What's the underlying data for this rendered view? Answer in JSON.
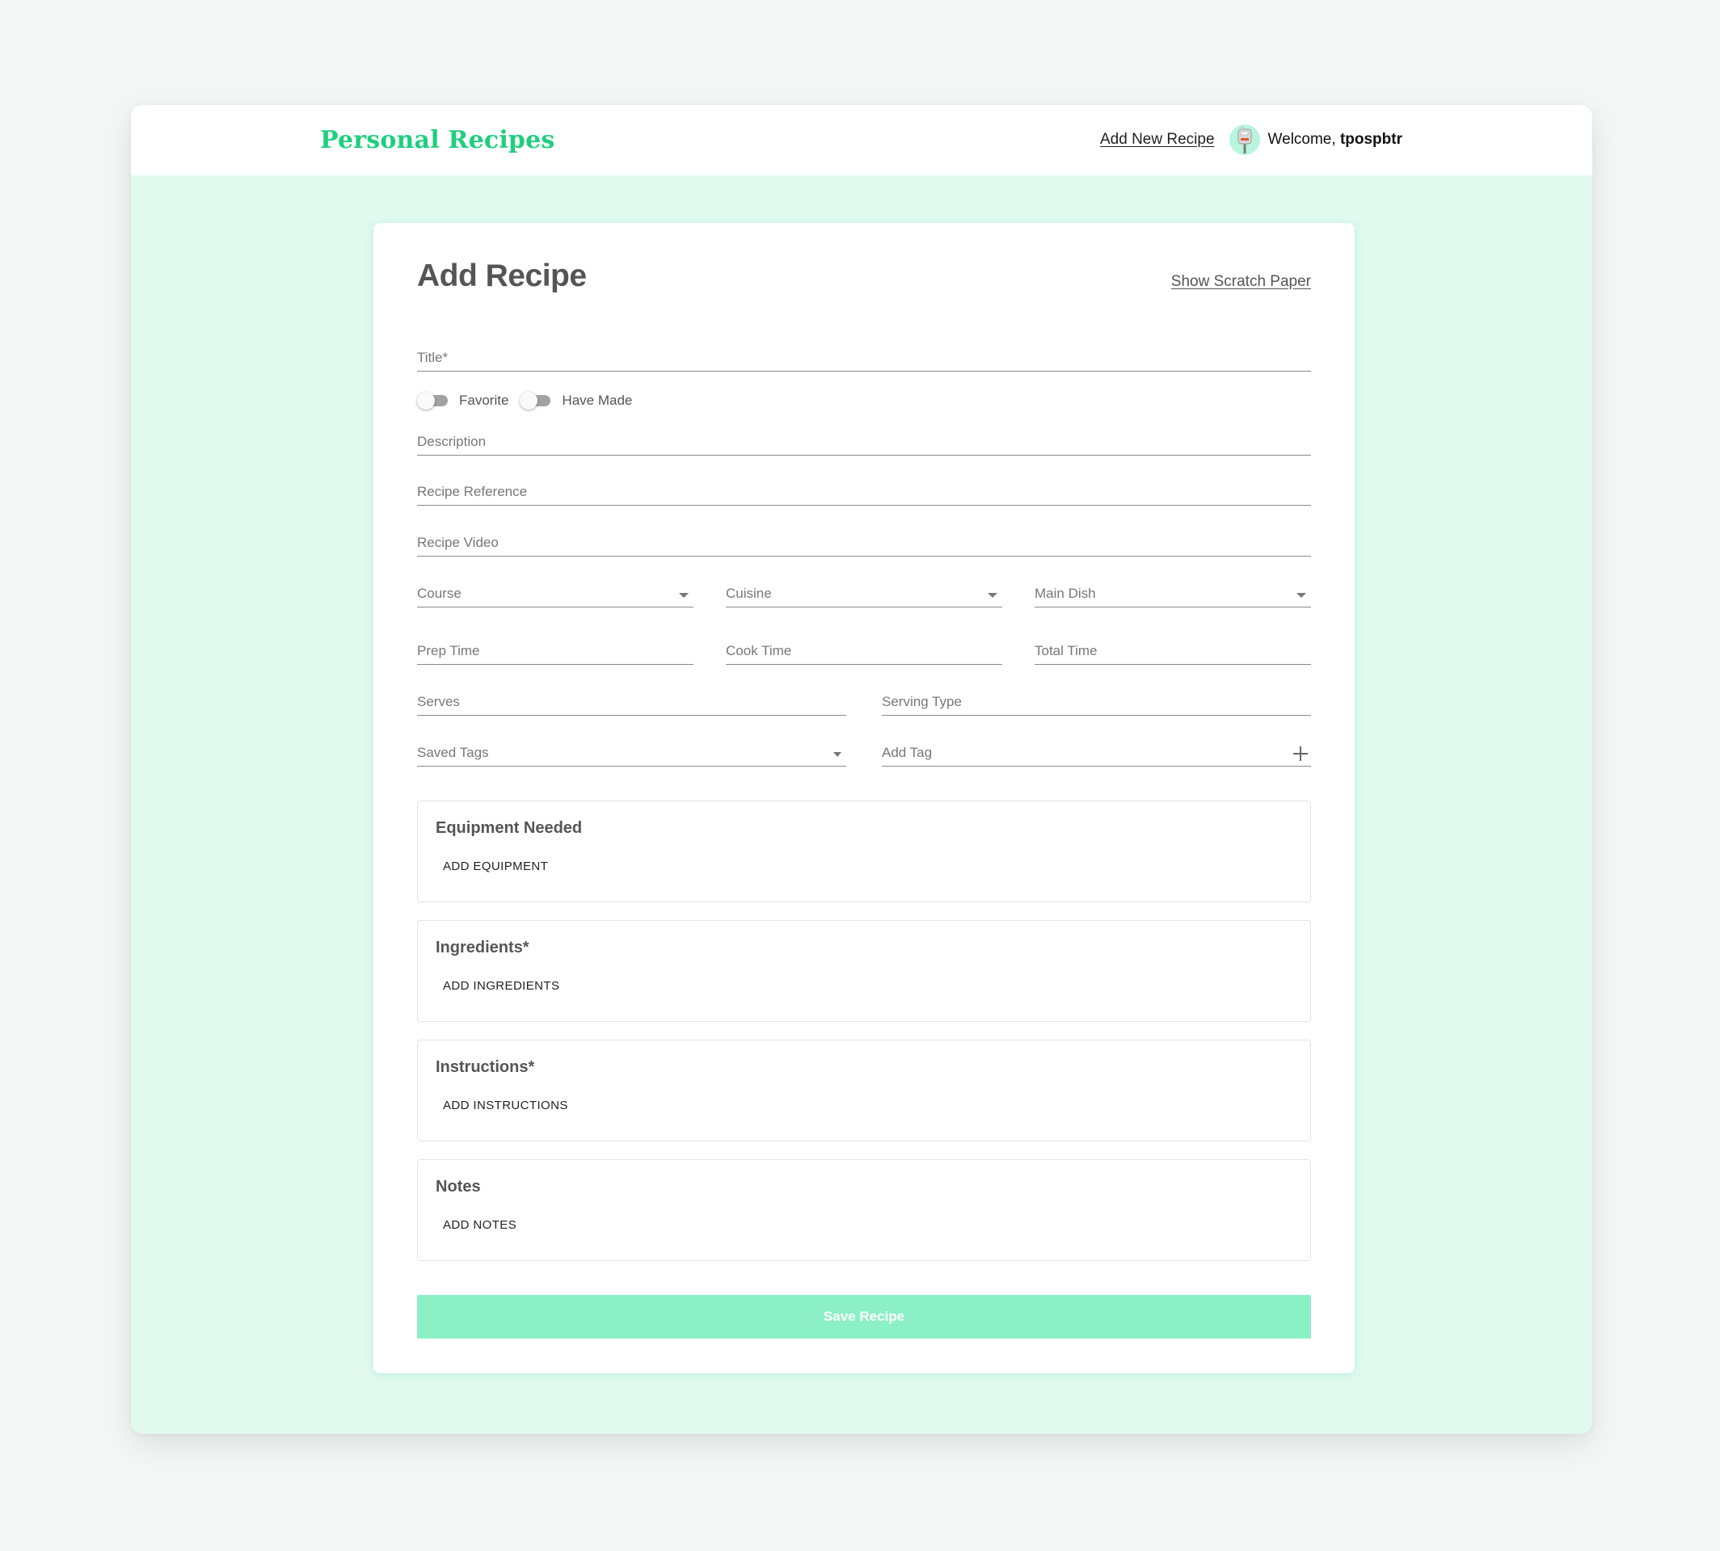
{
  "header": {
    "brand": "Personal Recipes",
    "add_new_recipe": "Add New Recipe",
    "welcome_prefix": "Welcome, ",
    "username": "tpospbtr",
    "avatar_icon": "parking-meter-avatar-icon"
  },
  "page": {
    "title": "Add Recipe",
    "scratch_link": "Show Scratch Paper"
  },
  "form": {
    "title_label": "Title*",
    "toggles": [
      {
        "label": "Favorite",
        "on": false
      },
      {
        "label": "Have Made",
        "on": false
      }
    ],
    "description_label": "Description",
    "reference_label": "Recipe Reference",
    "video_label": "Recipe Video",
    "course_label": "Course",
    "cuisine_label": "Cuisine",
    "main_dish_label": "Main Dish",
    "prep_time_label": "Prep Time",
    "cook_time_label": "Cook Time",
    "total_time_label": "Total Time",
    "serves_label": "Serves",
    "serving_type_label": "Serving Type",
    "saved_tags_label": "Saved Tags",
    "add_tag_label": "Add Tag"
  },
  "sections": [
    {
      "title": "Equipment Needed",
      "button": "ADD EQUIPMENT"
    },
    {
      "title": "Ingredients*",
      "button": "ADD INGREDIENTS"
    },
    {
      "title": "Instructions*",
      "button": "ADD INSTRUCTIONS"
    },
    {
      "title": "Notes",
      "button": "ADD NOTES"
    }
  ],
  "save_button": "Save Recipe",
  "colors": {
    "brand": "#1fcf7e",
    "page_background": "#e1f9ef",
    "save_button": "#8cf0c7"
  }
}
